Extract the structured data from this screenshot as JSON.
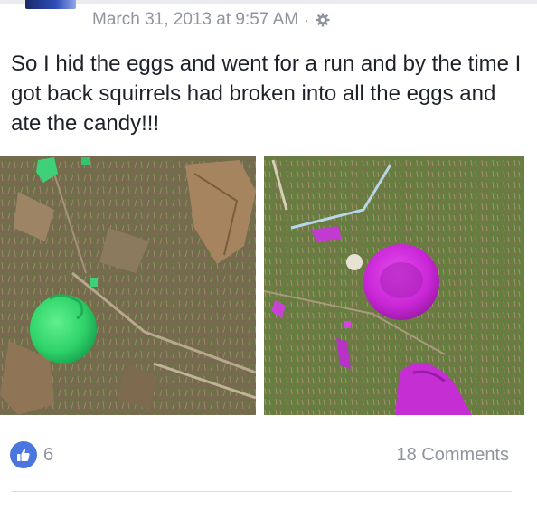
{
  "post": {
    "timestamp": "March 31, 2013 at 9:57 AM",
    "separator": "·",
    "privacy_icon": "gear-icon",
    "text": "So I hid the eggs and went for a run and by the time I got back squirrels had broken into all the eggs and ate the candy!!!"
  },
  "photos": [
    {
      "name": "photo-green-egg",
      "dominant_color": "#2fd36a"
    },
    {
      "name": "photo-purple-egg",
      "dominant_color": "#c927d6"
    }
  ],
  "footer": {
    "like_icon": "thumbs-up-icon",
    "like_count": "6",
    "comments_label": "18 Comments"
  },
  "colors": {
    "meta_text": "#90949c",
    "body_text": "#1d2129",
    "like_blue": "#4a76de"
  }
}
